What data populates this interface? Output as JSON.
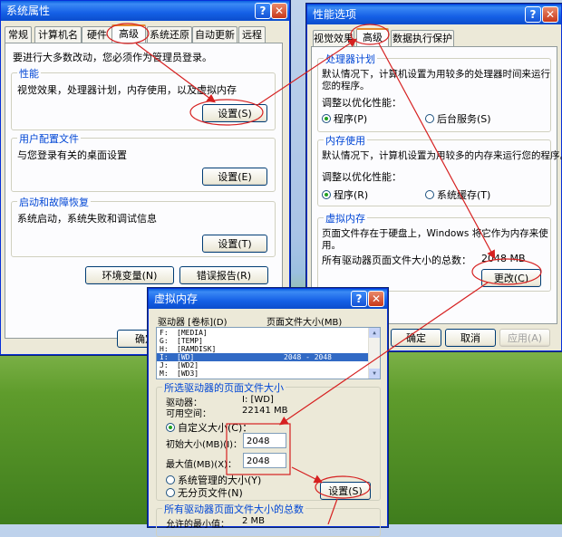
{
  "sys_props": {
    "title": "系统属性",
    "tabs": [
      "常规",
      "计算机名",
      "硬件",
      "高级",
      "系统还原",
      "自动更新",
      "远程"
    ],
    "admin_note": "要进行大多数改动，您必须作为管理员登录。",
    "perf_group": "性能",
    "perf_desc": "视觉效果，处理器计划，内存使用，以及虚拟内存",
    "perf_btn": "设置(S)",
    "profile_group": "用户配置文件",
    "profile_desc": "与您登录有关的桌面设置",
    "profile_btn": "设置(E)",
    "startup_group": "启动和故障恢复",
    "startup_desc": "系统启动，系统失败和调试信息",
    "startup_btn": "设置(T)",
    "env_btn": "环境变量(N)",
    "err_btn": "错误报告(R)",
    "ok_btn": "确定"
  },
  "perf_opts": {
    "title": "性能选项",
    "tabs": [
      "视觉效果",
      "高级",
      "数据执行保护"
    ],
    "cpu_group": "处理器计划",
    "cpu_desc1": "默认情况下，计算机设置为用较多的处理器时间来运行",
    "cpu_desc2": "您的程序。",
    "cpu_adjust": "调整以优化性能：",
    "cpu_opt1": "程序(P)",
    "cpu_opt2": "后台服务(S)",
    "mem_group": "内存使用",
    "mem_desc": "默认情况下，计算机设置为用较多的内存来运行您的程序。",
    "mem_adjust": "调整以优化性能：",
    "mem_opt1": "程序(R)",
    "mem_opt2": "系统缓存(T)",
    "vm_group": "虚拟内存",
    "vm_desc1": "页面文件存在于硬盘上，Windows 将它作为内存来使",
    "vm_desc2": "用。",
    "vm_total_label": "所有驱动器页面文件大小的总数：",
    "vm_total_value": "2048 MB",
    "vm_change_btn": "更改(C)",
    "ok_btn": "确定",
    "cancel_btn": "取消",
    "apply_btn": "应用(A)"
  },
  "vmem": {
    "title": "虚拟内存",
    "col_drive": "驱动器 [卷标](D)",
    "col_size": "页面文件大小(MB)",
    "drives": [
      {
        "d": "F:",
        "label": "[MEDIA]",
        "size": ""
      },
      {
        "d": "G:",
        "label": "[TEMP]",
        "size": ""
      },
      {
        "d": "H:",
        "label": "[RAMDISK]",
        "size": ""
      },
      {
        "d": "I:",
        "label": "[WD]",
        "size": "2048 - 2048"
      },
      {
        "d": "J:",
        "label": "[WD2]",
        "size": ""
      },
      {
        "d": "M:",
        "label": "[WD3]",
        "size": ""
      }
    ],
    "selected_index": 3,
    "sel_group": "所选驱动器的页面文件大小",
    "drive_label": "驱动器：",
    "drive_value": "I:  [WD]",
    "space_label": "可用空间：",
    "space_value": "22141 MB",
    "custom_size": "自定义大小(C)：",
    "initial_label": "初始大小(MB)(I)：",
    "initial_value": "2048",
    "max_label": "最大值(MB)(X)：",
    "max_value": "2048",
    "sys_managed": "系统管理的大小(Y)",
    "no_paging": "无分页文件(N)",
    "set_btn": "设置(S)",
    "total_group": "所有驱动器页面文件大小的总数",
    "min_allowed_label": "允许的最小值：",
    "min_allowed_value": "2 MB"
  },
  "colors": {
    "annotation": "#d62020",
    "title_bar": "#0a5fe0",
    "accent_tab": "#e68b2c"
  }
}
